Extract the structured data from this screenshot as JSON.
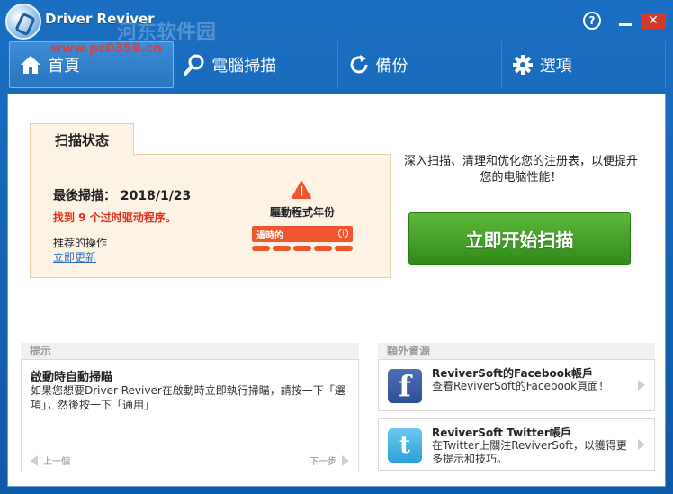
{
  "app": {
    "title": "Driver Reviver",
    "watermark": "河东软件园",
    "watermark_url": "www.pc0359.cn"
  },
  "window_controls": {
    "help": "?",
    "close": "✕"
  },
  "nav": {
    "items": [
      {
        "label": "首頁",
        "icon": "home-icon",
        "active": true
      },
      {
        "label": "電腦掃描",
        "icon": "search-icon",
        "active": false
      },
      {
        "label": "備份",
        "icon": "refresh-icon",
        "active": false
      },
      {
        "label": "選項",
        "icon": "gear-icon",
        "active": false
      }
    ]
  },
  "scan_status": {
    "tab_label": "扫描状态",
    "last_scan": "最後掃描： 2018/1/23",
    "found": "找到 9 个过时驱动程序。",
    "recommended_label": "推荐的操作",
    "update_link": "立即更新",
    "age_label": "驅動程式年份",
    "age_bar_text": "過時的",
    "age_info": "i"
  },
  "promo": {
    "text": "深入扫描、清理和优化您的注册表，以便提升您的电脑性能！",
    "scan_button": "立即开始扫描"
  },
  "tips": {
    "header": "提示",
    "title": "啟動時自動掃瞄",
    "body": "如果您想要Driver Reviver在啟動時立即執行掃瞄，請按一下「選項」，然後按一下「通用」",
    "prev": "上一個",
    "next": "下一步"
  },
  "resources": {
    "header": "額外資源",
    "facebook": {
      "title": "ReviverSoft的Facebook帳戶",
      "desc": "查看ReviverSoft的Facebook頁面！",
      "icon_glyph": "f"
    },
    "twitter": {
      "title": "ReviverSoft Twitter帳戶",
      "desc": "在Twitter上關注ReviverSoft，以獲得更多提示和技巧。",
      "icon_glyph": "t"
    }
  },
  "colors": {
    "accent_blue": "#1560b0",
    "scan_green": "#2f8c1b",
    "warning_red": "#e0301e",
    "age_bar": "#f0552d"
  }
}
